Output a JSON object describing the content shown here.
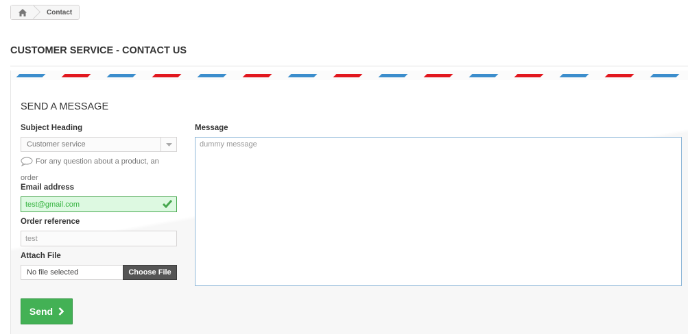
{
  "breadcrumb": {
    "home_icon": "home-icon",
    "current": "Contact"
  },
  "page": {
    "heading": "CUSTOMER SERVICE - CONTACT US"
  },
  "form": {
    "title": "SEND A MESSAGE",
    "subject_label": "Subject Heading",
    "subject_value": "Customer service",
    "subject_hint_line1": "For any question about a product, an",
    "subject_hint_line2": "order",
    "email_label": "Email address",
    "email_value": "test@gmail.com",
    "order_label": "Order reference",
    "order_value": "test",
    "file_label": "Attach File",
    "file_value": "No file selected",
    "file_button": "Choose File",
    "message_label": "Message",
    "message_value": "dummy message",
    "send_label": "Send"
  },
  "colors": {
    "stripe_blue": "#3b8dcc",
    "stripe_red": "#e1171e",
    "valid_green": "#46a74e",
    "send_green": "#43b155"
  }
}
